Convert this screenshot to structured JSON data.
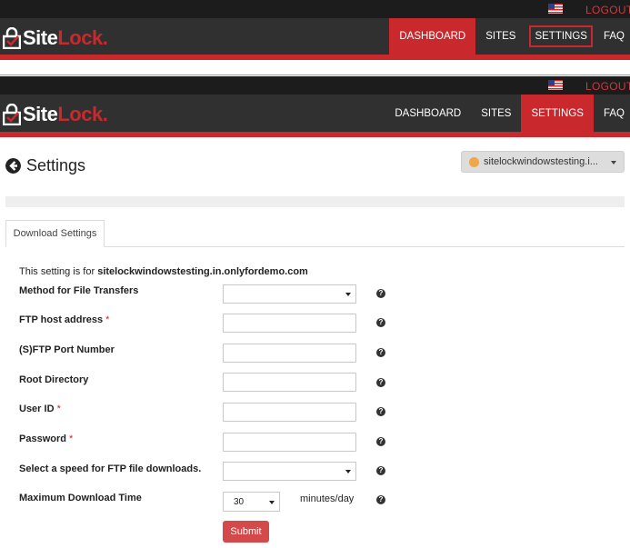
{
  "header": {
    "logo": {
      "site": "Site",
      "lock": "Lock",
      "dot": "."
    },
    "logout_label": "LOGOUT",
    "flag_icon": "us-flag-icon",
    "nav": {
      "dashboard": "DASHBOARD",
      "sites": "SITES",
      "settings": "SETTINGS",
      "faq": "FAQ"
    }
  },
  "page": {
    "title": "Settings",
    "back_icon": "arrow-left-circle-icon",
    "site_selector": {
      "value": "sitelockwindowstesting.i..."
    },
    "tab_label": "Download Settings",
    "info_prefix": "This setting is for ",
    "info_domain": "sitelockwindowstesting.in.onlyfordemo.com"
  },
  "form": {
    "method_label": "Method for File Transfers",
    "host_label": "FTP host address",
    "port_label": "(S)FTP Port Number",
    "root_label": "Root Directory",
    "user_label": "User ID",
    "password_label": "Password",
    "speed_label": "Select a speed for FTP file downloads.",
    "max_time_label": "Maximum Download Time",
    "required_mark": "*",
    "help_glyph": "?",
    "max_time_value": "30",
    "max_time_unit": "minutes/day",
    "submit_label": "Submit"
  },
  "colors": {
    "brand_red": "#c9282d",
    "header_dark": "#303030",
    "submit": "#d44a4a"
  }
}
